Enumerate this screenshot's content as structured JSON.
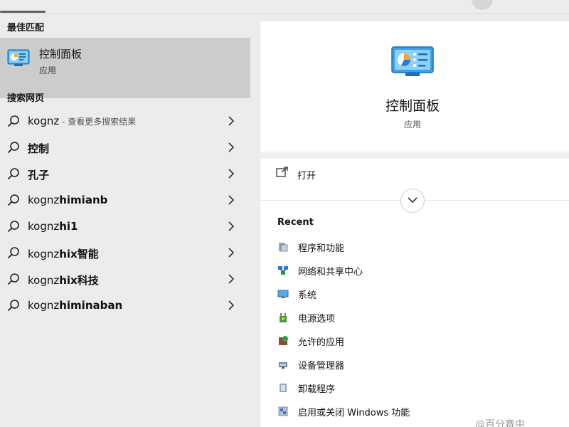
{
  "left": {
    "best_match_label": "最佳匹配",
    "best_match": {
      "title": "控制面板",
      "subtitle": "应用",
      "icon": "control-panel-icon"
    },
    "web_label": "搜索网页",
    "suggestions": [
      {
        "prefix": "kognz",
        "bold": "",
        "hint": " - 查看更多搜索结果"
      },
      {
        "prefix": "",
        "bold": "控制",
        "hint": ""
      },
      {
        "prefix": "",
        "bold": "孔子",
        "hint": ""
      },
      {
        "prefix": "kognz",
        "bold": "himianb",
        "hint": ""
      },
      {
        "prefix": "kognz",
        "bold": "hi1",
        "hint": ""
      },
      {
        "prefix": "kognz",
        "bold": "hix智能",
        "hint": ""
      },
      {
        "prefix": "kognz",
        "bold": "hix科技",
        "hint": ""
      },
      {
        "prefix": "kognz",
        "bold": "himinaban",
        "hint": ""
      }
    ]
  },
  "right": {
    "app_title": "控制面板",
    "app_subtitle": "应用",
    "open_label": "打开",
    "recent_label": "Recent",
    "recent_items": [
      {
        "label": "程序和功能",
        "icon": "programs-features-icon"
      },
      {
        "label": "网络和共享中心",
        "icon": "network-sharing-icon"
      },
      {
        "label": "系统",
        "icon": "system-icon"
      },
      {
        "label": "电源选项",
        "icon": "power-options-icon"
      },
      {
        "label": "允许的应用",
        "icon": "allowed-apps-icon"
      },
      {
        "label": "设备管理器",
        "icon": "device-manager-icon"
      },
      {
        "label": "卸载程序",
        "icon": "uninstall-program-icon"
      },
      {
        "label": "启用或关闭 Windows 功能",
        "icon": "windows-features-icon"
      }
    ]
  },
  "watermark": "@百分赛中",
  "colors": {
    "selected_bg": "#cccccc",
    "panel_bg": "#ffffff",
    "page_bg": "#ececec",
    "accent_blue": "#2b7bd8"
  }
}
